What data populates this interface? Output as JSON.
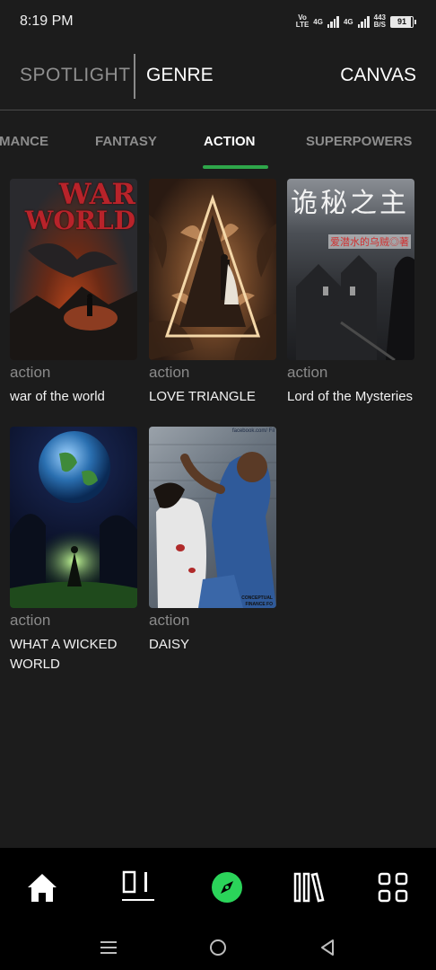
{
  "status_bar": {
    "time": "8:19 PM",
    "volte_top": "Vo",
    "volte_bottom": "LTE",
    "net1": "4G",
    "net2": "4G",
    "speed_value": "443",
    "speed_unit": "B/S",
    "battery": "91"
  },
  "top_nav": {
    "spotlight": "SPOTLIGHT",
    "genre": "GENRE",
    "canvas": "CANVAS"
  },
  "genre_tabs": [
    {
      "label": "MANCE",
      "active": false
    },
    {
      "label": "FANTASY",
      "active": false
    },
    {
      "label": "ACTION",
      "active": true
    },
    {
      "label": "SUPERPOWERS",
      "active": false
    }
  ],
  "books": [
    {
      "genre": "action",
      "title": "war of the world",
      "cover_text": [
        "WAR",
        "WORLD"
      ]
    },
    {
      "genre": "action",
      "title": "LOVE TRIANGLE"
    },
    {
      "genre": "action",
      "title": "Lord of the Mysteries",
      "cover_text": [
        "诡秘之主",
        "爱潜水的乌贼◎著"
      ]
    },
    {
      "genre": "action",
      "title": "WHAT A WICKED WORLD"
    },
    {
      "genre": "action",
      "title": "DAISY",
      "cover_text": [
        "facebook.com/ Fil",
        "CONCEPTUAL",
        "FINANCE FO"
      ]
    }
  ],
  "bottom_nav": [
    "home-icon",
    "library-shelf-icon",
    "compass-icon",
    "books-icon",
    "grid-icon"
  ],
  "colors": {
    "accent": "#2ea64a",
    "background": "#1c1c1c"
  }
}
